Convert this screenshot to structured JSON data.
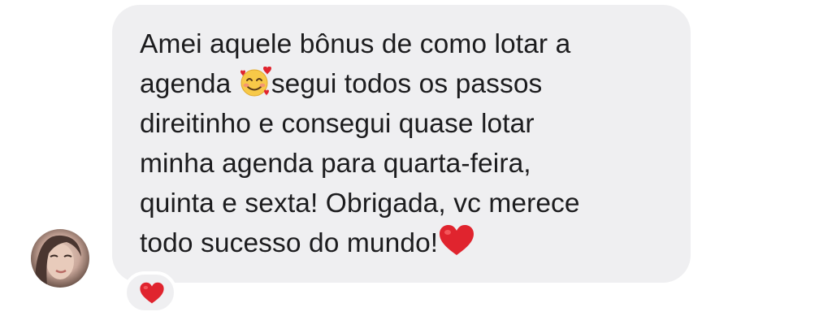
{
  "message": {
    "lines": [
      "Amei aquele bônus de como lotar a",
      "agenda",
      "segui todos os passos",
      "direitinho e consegui quase lotar",
      "minha agenda para quarta-feira,",
      "quinta e sexta! Obrigada, vc merece",
      "todo sucesso do mundo!"
    ],
    "inline_emoji_1": "smiling-face-with-hearts-icon",
    "inline_emoji_2": "red-heart-icon"
  },
  "reaction": {
    "emoji": "red-heart-icon"
  },
  "colors": {
    "bubble": "#efeff1",
    "text": "#1c1c1e",
    "heart": "#e0242e"
  }
}
